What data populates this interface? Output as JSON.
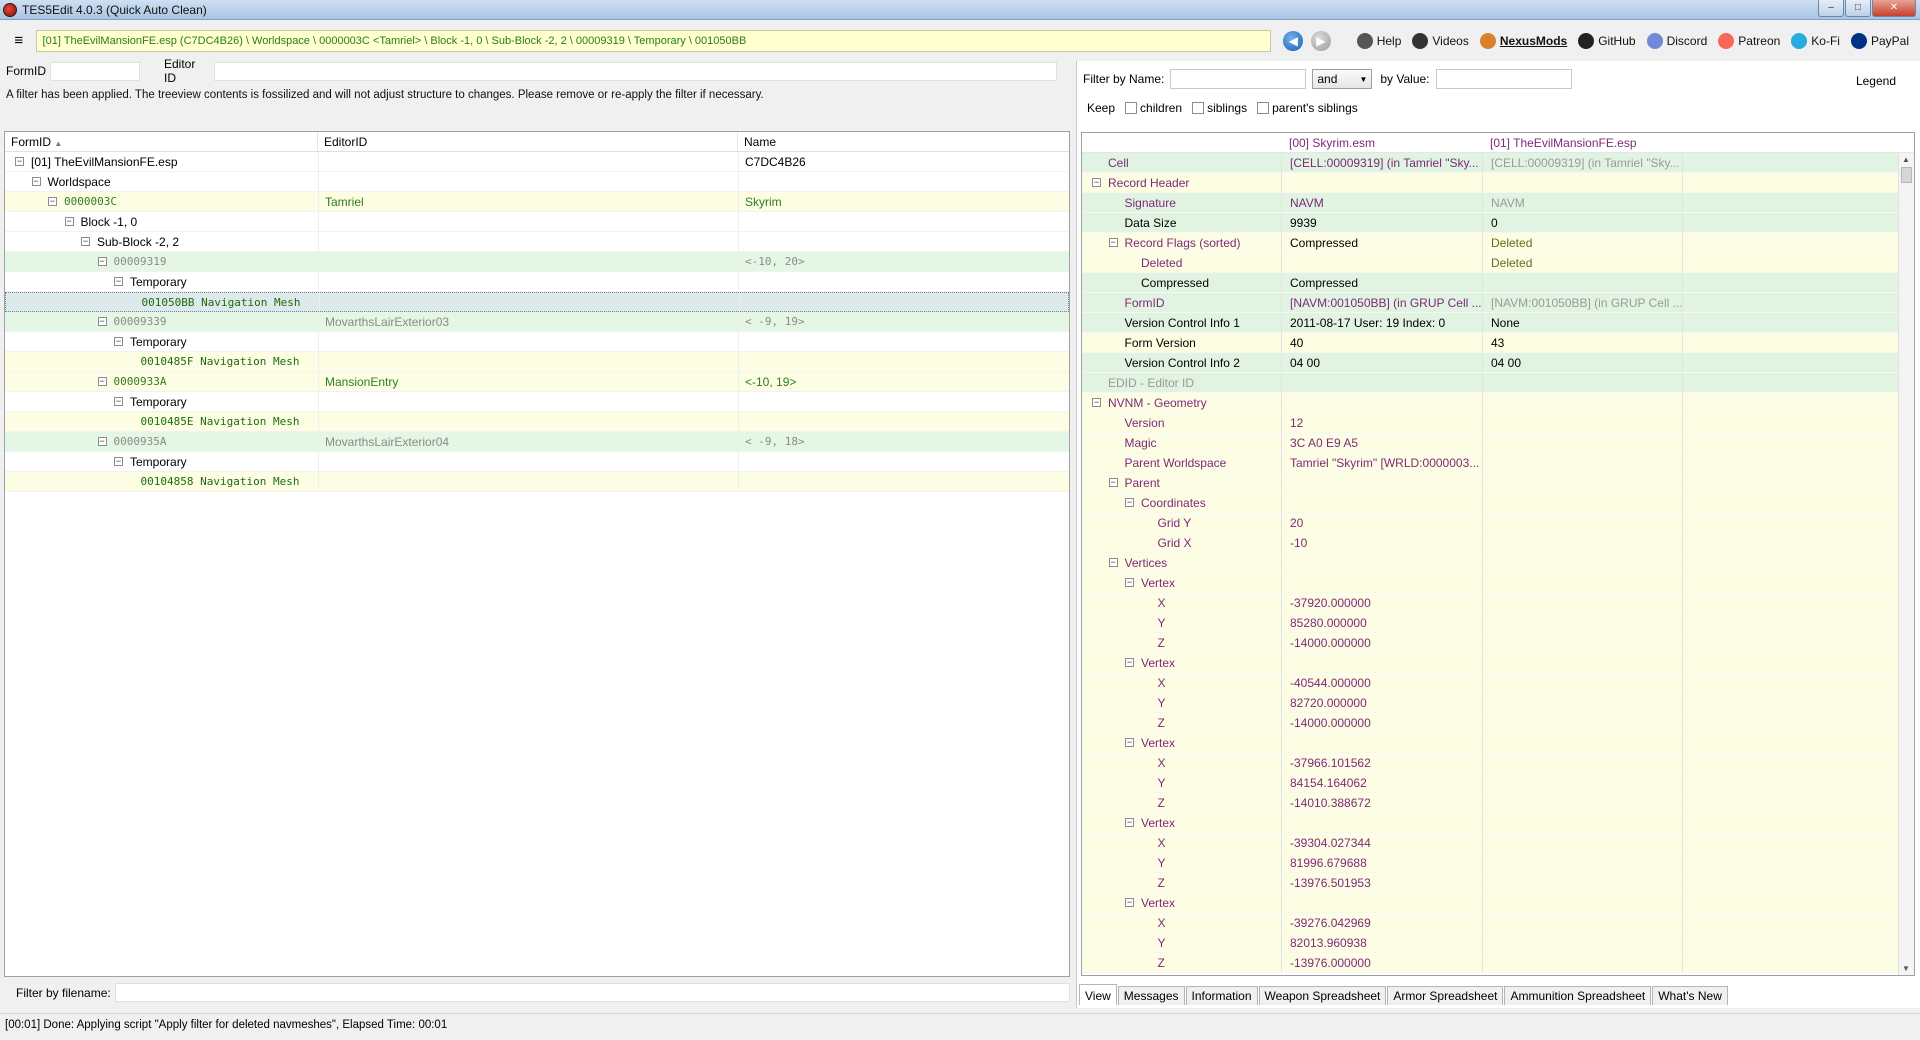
{
  "window": {
    "title": "TES5Edit 4.0.3 (Quick Auto Clean)",
    "minimize": "–",
    "maximize": "□",
    "close": "✕"
  },
  "toolbar": {
    "menu_icon": "≡",
    "path": "[01] TheEvilMansionFE.esp (C7DC4B26) \\ Worldspace \\ 0000003C <Tamriel> \\ Block -1, 0 \\ Sub-Block -2, 2 \\ 00009319 \\ Temporary \\ 001050BB",
    "back_icon": "back-arrow-icon",
    "forward_icon": "forward-arrow-icon",
    "links": [
      {
        "label": "Help",
        "icon": "book-icon",
        "color": "#555555"
      },
      {
        "label": "Videos",
        "icon": "video-icon",
        "color": "#333333"
      },
      {
        "label": "NexusMods",
        "icon": "nexus-icon",
        "color": "#d9822b"
      },
      {
        "label": "GitHub",
        "icon": "github-icon",
        "color": "#222222"
      },
      {
        "label": "Discord",
        "icon": "discord-icon",
        "color": "#7289da"
      },
      {
        "label": "Patreon",
        "icon": "patreon-icon",
        "color": "#f96854"
      },
      {
        "label": "Ko-Fi",
        "icon": "kofi-icon",
        "color": "#29abe0"
      },
      {
        "label": "PayPal",
        "icon": "paypal-icon",
        "color": "#003087"
      }
    ]
  },
  "left": {
    "formid_label": "FormID",
    "editorid_label": "Editor ID",
    "notice": "A filter has been applied. The treeview contents is fossilized and will not adjust structure to changes.  Please remove or re-apply the filter if necessary.",
    "columns": [
      "FormID",
      "EditorID",
      "Name"
    ],
    "sort_glyph": "▲",
    "rows": [
      {
        "level": 0,
        "exp": "⊟",
        "label": "[01] TheEvilMansionFE.esp",
        "editor": "",
        "name": "C7DC4B26",
        "style": "",
        "cls": ""
      },
      {
        "level": 1,
        "exp": "⊟",
        "label": "Worldspace",
        "editor": "",
        "name": "",
        "style": "",
        "cls": ""
      },
      {
        "level": 2,
        "exp": "⊟",
        "label": "0000003C",
        "editor": "Tamriel",
        "name": "Skyrim",
        "style": "c1",
        "cls": "green mono"
      },
      {
        "level": 3,
        "exp": "⊟",
        "label": "Block -1, 0",
        "editor": "",
        "name": "",
        "style": "",
        "cls": ""
      },
      {
        "level": 4,
        "exp": "⊟",
        "label": "Sub-Block -2, 2",
        "editor": "",
        "name": "",
        "style": "",
        "cls": ""
      },
      {
        "level": 5,
        "exp": "⊟",
        "label": "00009319",
        "editor": "",
        "name": "<-10, 20>",
        "style": "c2",
        "cls": "gray mono"
      },
      {
        "level": 6,
        "exp": "⊟",
        "label": "Temporary",
        "editor": "",
        "name": "",
        "style": "",
        "cls": ""
      },
      {
        "level": 7,
        "exp": "",
        "label": "001050BB  Navigation Mesh",
        "editor": "",
        "name": "",
        "style": "sel",
        "cls": "dkgreen mono"
      },
      {
        "level": 5,
        "exp": "⊟",
        "label": "00009339",
        "editor": "MovarthsLairExterior03",
        "name": "< -9, 19>",
        "style": "c2",
        "cls": "gray mono"
      },
      {
        "level": 6,
        "exp": "⊟",
        "label": "Temporary",
        "editor": "",
        "name": "",
        "style": "",
        "cls": ""
      },
      {
        "level": 7,
        "exp": "",
        "label": "0010485F  Navigation Mesh",
        "editor": "",
        "name": "",
        "style": "c1",
        "cls": "dkgreen mono"
      },
      {
        "level": 5,
        "exp": "⊟",
        "label": "0000933A",
        "editor": "MansionEntry",
        "name": "<-10, 19>",
        "style": "c1",
        "cls": "green mono"
      },
      {
        "level": 6,
        "exp": "⊟",
        "label": "Temporary",
        "editor": "",
        "name": "",
        "style": "",
        "cls": ""
      },
      {
        "level": 7,
        "exp": "",
        "label": "0010485E  Navigation Mesh",
        "editor": "",
        "name": "",
        "style": "c1",
        "cls": "dkgreen mono"
      },
      {
        "level": 5,
        "exp": "⊟",
        "label": "0000935A",
        "editor": "MovarthsLairExterior04",
        "name": "< -9, 18>",
        "style": "c2",
        "cls": "gray mono"
      },
      {
        "level": 6,
        "exp": "⊟",
        "label": "Temporary",
        "editor": "",
        "name": "",
        "style": "",
        "cls": ""
      },
      {
        "level": 7,
        "exp": "",
        "label": "00104858  Navigation Mesh",
        "editor": "",
        "name": "",
        "style": "c1",
        "cls": "dkgreen mono"
      }
    ],
    "filter_by_filename": "Filter by filename:"
  },
  "right": {
    "filter_by_name": "Filter by Name:",
    "operator": "and",
    "by_value": "by Value:",
    "legend": "Legend",
    "keep": "Keep",
    "keep_children": "children",
    "keep_siblings": "siblings",
    "keep_parents_siblings": "parent's siblings",
    "col_master": "[00] Skyrim.esm",
    "col_plugin": "[01] TheEvilMansionFE.esp",
    "rows": [
      {
        "level": 0,
        "exp": "",
        "label": "Cell",
        "v1": "[CELL:00009319] (in Tamriel \"Sky...",
        "v2": "[CELL:00009319] (in Tamriel \"Sky...",
        "bg": "g",
        "lc": "purple",
        "c1": "purple",
        "c2": "lgray"
      },
      {
        "level": 0,
        "exp": "⊟",
        "label": "Record Header",
        "v1": "",
        "v2": "",
        "bg": "y",
        "lc": "purple",
        "c1": "",
        "c2": ""
      },
      {
        "level": 1,
        "exp": "",
        "label": "Signature",
        "v1": "NAVM",
        "v2": "NAVM",
        "bg": "g",
        "lc": "purple",
        "c1": "purple",
        "c2": "lgray"
      },
      {
        "level": 1,
        "exp": "",
        "label": "Data Size",
        "v1": "9939",
        "v2": "0",
        "bg": "g",
        "lc": "",
        "c1": "",
        "c2": ""
      },
      {
        "level": 1,
        "exp": "⊟",
        "label": "Record Flags (sorted)",
        "v1": "Compressed",
        "v2": "Deleted",
        "bg": "y",
        "lc": "purple",
        "c1": "",
        "c2": "olive"
      },
      {
        "level": 2,
        "exp": "",
        "label": "Deleted",
        "v1": "",
        "v2": "Deleted",
        "bg": "y",
        "lc": "purple",
        "c1": "",
        "c2": "olive"
      },
      {
        "level": 2,
        "exp": "",
        "label": "Compressed",
        "v1": "Compressed",
        "v2": "",
        "bg": "g",
        "lc": "",
        "c1": "",
        "c2": ""
      },
      {
        "level": 1,
        "exp": "",
        "label": "FormID",
        "v1": "[NAVM:001050BB] (in GRUP Cell ...",
        "v2": "[NAVM:001050BB] (in GRUP Cell ...",
        "bg": "g",
        "lc": "purple",
        "c1": "purple",
        "c2": "lgray"
      },
      {
        "level": 1,
        "exp": "",
        "label": "Version Control Info 1",
        "v1": "2011-08-17 User: 19 Index: 0",
        "v2": "None",
        "bg": "g",
        "lc": "",
        "c1": "",
        "c2": ""
      },
      {
        "level": 1,
        "exp": "",
        "label": "Form Version",
        "v1": "40",
        "v2": "43",
        "bg": "y",
        "lc": "",
        "c1": "",
        "c2": ""
      },
      {
        "level": 1,
        "exp": "",
        "label": "Version Control Info 2",
        "v1": "04 00",
        "v2": "04 00",
        "bg": "g",
        "lc": "",
        "c1": "",
        "c2": ""
      },
      {
        "level": 0,
        "exp": "",
        "label": "EDID - Editor ID",
        "v1": "",
        "v2": "",
        "bg": "g",
        "lc": "lgray",
        "c1": "",
        "c2": ""
      },
      {
        "level": 0,
        "exp": "⊟",
        "label": "NVNM - Geometry",
        "v1": "",
        "v2": "",
        "bg": "y",
        "lc": "purple",
        "c1": "",
        "c2": ""
      },
      {
        "level": 1,
        "exp": "",
        "label": "Version",
        "v1": "12",
        "v2": "",
        "bg": "y",
        "lc": "purple",
        "c1": "purple",
        "c2": ""
      },
      {
        "level": 1,
        "exp": "",
        "label": "Magic",
        "v1": "3C A0 E9 A5",
        "v2": "",
        "bg": "y",
        "lc": "purple",
        "c1": "purple",
        "c2": ""
      },
      {
        "level": 1,
        "exp": "",
        "label": "Parent Worldspace",
        "v1": "Tamriel \"Skyrim\" [WRLD:0000003...",
        "v2": "",
        "bg": "y",
        "lc": "purple",
        "c1": "purple",
        "c2": ""
      },
      {
        "level": 1,
        "exp": "⊟",
        "label": "Parent",
        "v1": "",
        "v2": "",
        "bg": "y",
        "lc": "purple",
        "c1": "",
        "c2": ""
      },
      {
        "level": 2,
        "exp": "⊟",
        "label": "Coordinates",
        "v1": "",
        "v2": "",
        "bg": "y",
        "lc": "purple",
        "c1": "",
        "c2": ""
      },
      {
        "level": 3,
        "exp": "",
        "label": "Grid Y",
        "v1": "20",
        "v2": "",
        "bg": "y",
        "lc": "purple",
        "c1": "purple",
        "c2": ""
      },
      {
        "level": 3,
        "exp": "",
        "label": "Grid X",
        "v1": "-10",
        "v2": "",
        "bg": "y",
        "lc": "purple",
        "c1": "purple",
        "c2": ""
      },
      {
        "level": 1,
        "exp": "⊟",
        "label": "Vertices",
        "v1": "",
        "v2": "",
        "bg": "y",
        "lc": "purple",
        "c1": "",
        "c2": ""
      },
      {
        "level": 2,
        "exp": "⊟",
        "label": "Vertex",
        "v1": "",
        "v2": "",
        "bg": "y",
        "lc": "purple",
        "c1": "",
        "c2": ""
      },
      {
        "level": 3,
        "exp": "",
        "label": "X",
        "v1": "-37920.000000",
        "v2": "",
        "bg": "y",
        "lc": "purple",
        "c1": "purple",
        "c2": ""
      },
      {
        "level": 3,
        "exp": "",
        "label": "Y",
        "v1": "85280.000000",
        "v2": "",
        "bg": "y",
        "lc": "purple",
        "c1": "purple",
        "c2": ""
      },
      {
        "level": 3,
        "exp": "",
        "label": "Z",
        "v1": "-14000.000000",
        "v2": "",
        "bg": "y",
        "lc": "purple",
        "c1": "purple",
        "c2": ""
      },
      {
        "level": 2,
        "exp": "⊟",
        "label": "Vertex",
        "v1": "",
        "v2": "",
        "bg": "y",
        "lc": "purple",
        "c1": "",
        "c2": ""
      },
      {
        "level": 3,
        "exp": "",
        "label": "X",
        "v1": "-40544.000000",
        "v2": "",
        "bg": "y",
        "lc": "purple",
        "c1": "purple",
        "c2": ""
      },
      {
        "level": 3,
        "exp": "",
        "label": "Y",
        "v1": "82720.000000",
        "v2": "",
        "bg": "y",
        "lc": "purple",
        "c1": "purple",
        "c2": ""
      },
      {
        "level": 3,
        "exp": "",
        "label": "Z",
        "v1": "-14000.000000",
        "v2": "",
        "bg": "y",
        "lc": "purple",
        "c1": "purple",
        "c2": ""
      },
      {
        "level": 2,
        "exp": "⊟",
        "label": "Vertex",
        "v1": "",
        "v2": "",
        "bg": "y",
        "lc": "purple",
        "c1": "",
        "c2": ""
      },
      {
        "level": 3,
        "exp": "",
        "label": "X",
        "v1": "-37966.101562",
        "v2": "",
        "bg": "y",
        "lc": "purple",
        "c1": "purple",
        "c2": ""
      },
      {
        "level": 3,
        "exp": "",
        "label": "Y",
        "v1": "84154.164062",
        "v2": "",
        "bg": "y",
        "lc": "purple",
        "c1": "purple",
        "c2": ""
      },
      {
        "level": 3,
        "exp": "",
        "label": "Z",
        "v1": "-14010.388672",
        "v2": "",
        "bg": "y",
        "lc": "purple",
        "c1": "purple",
        "c2": ""
      },
      {
        "level": 2,
        "exp": "⊟",
        "label": "Vertex",
        "v1": "",
        "v2": "",
        "bg": "y",
        "lc": "purple",
        "c1": "",
        "c2": ""
      },
      {
        "level": 3,
        "exp": "",
        "label": "X",
        "v1": "-39304.027344",
        "v2": "",
        "bg": "y",
        "lc": "purple",
        "c1": "purple",
        "c2": ""
      },
      {
        "level": 3,
        "exp": "",
        "label": "Y",
        "v1": "81996.679688",
        "v2": "",
        "bg": "y",
        "lc": "purple",
        "c1": "purple",
        "c2": ""
      },
      {
        "level": 3,
        "exp": "",
        "label": "Z",
        "v1": "-13976.501953",
        "v2": "",
        "bg": "y",
        "lc": "purple",
        "c1": "purple",
        "c2": ""
      },
      {
        "level": 2,
        "exp": "⊟",
        "label": "Vertex",
        "v1": "",
        "v2": "",
        "bg": "y",
        "lc": "purple",
        "c1": "",
        "c2": ""
      },
      {
        "level": 3,
        "exp": "",
        "label": "X",
        "v1": "-39276.042969",
        "v2": "",
        "bg": "y",
        "lc": "purple",
        "c1": "purple",
        "c2": ""
      },
      {
        "level": 3,
        "exp": "",
        "label": "Y",
        "v1": "82013.960938",
        "v2": "",
        "bg": "y",
        "lc": "purple",
        "c1": "purple",
        "c2": ""
      },
      {
        "level": 3,
        "exp": "",
        "label": "Z",
        "v1": "-13976.000000",
        "v2": "",
        "bg": "y",
        "lc": "purple",
        "c1": "purple",
        "c2": ""
      }
    ],
    "tabs": [
      "View",
      "Messages",
      "Information",
      "Weapon Spreadsheet",
      "Armor Spreadsheet",
      "Ammunition Spreadsheet",
      "What's New"
    ],
    "active_tab": "View"
  },
  "status": "[00:01] Done: Applying script \"Apply filter for deleted navmeshes\", Elapsed Time: 00:01"
}
